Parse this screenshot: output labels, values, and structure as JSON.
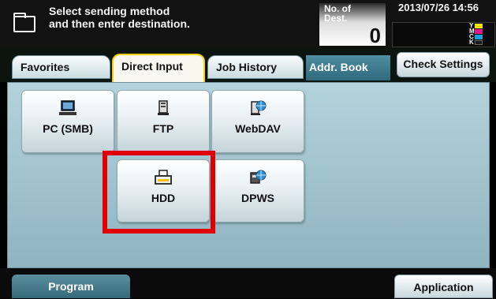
{
  "header": {
    "instruction": "Select sending method\nand then enter destination.",
    "dest_label": "No. of\nDest.",
    "dest_count": "0",
    "datetime": "2013/07/26 14:56",
    "toner": [
      {
        "label": "Y",
        "color": "#f5e400"
      },
      {
        "label": "M",
        "color": "#e0198a"
      },
      {
        "label": "C",
        "color": "#1ca0e0"
      },
      {
        "label": "K",
        "color": "#1a1a1a"
      }
    ]
  },
  "tabs": {
    "favorites": "Favorites",
    "direct_input": "Direct Input",
    "job_history": "Job History",
    "addr_book": "Addr. Book",
    "check_settings": "Check Settings"
  },
  "tiles": {
    "pc_smb": {
      "label": "PC (SMB)",
      "icon": "computer-icon"
    },
    "ftp": {
      "label": "FTP",
      "icon": "server-icon"
    },
    "webdav": {
      "label": "WebDAV",
      "icon": "web-server-icon"
    },
    "hdd": {
      "label": "HDD",
      "icon": "printer-hdd-icon"
    },
    "dpws": {
      "label": "DPWS",
      "icon": "network-device-icon"
    }
  },
  "footer": {
    "program": "Program",
    "application": "Application"
  },
  "colors": {
    "active_tab_border": "#f5d20a",
    "highlight": "#e00000",
    "panel": "#a4c6d0"
  }
}
